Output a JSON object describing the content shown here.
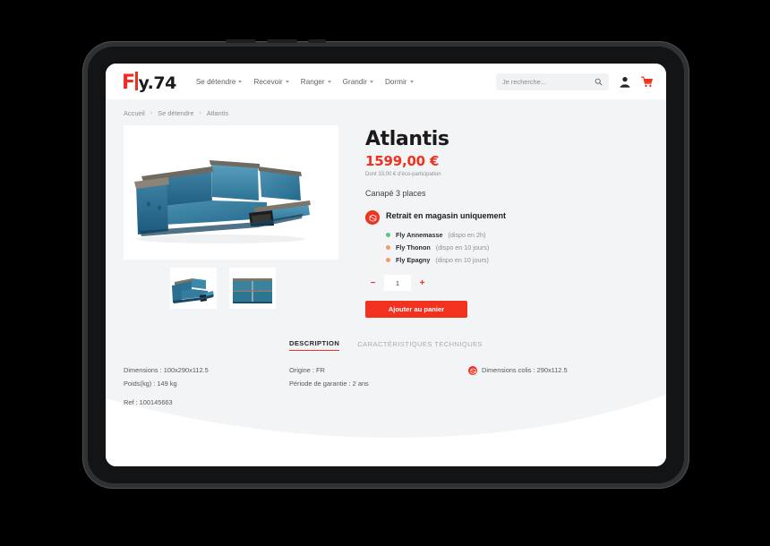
{
  "header": {
    "logo": {
      "prefix": "F",
      "suffix": "y.74"
    },
    "nav": [
      {
        "label": "Se détendre",
        "icon": "chevron-down-icon"
      },
      {
        "label": "Recevoir",
        "icon": "chevron-down-icon"
      },
      {
        "label": "Ranger",
        "icon": "chevron-down-icon"
      },
      {
        "label": "Grandir",
        "icon": "chevron-down-icon"
      },
      {
        "label": "Dormir",
        "icon": "chevron-down-icon"
      }
    ],
    "search": {
      "placeholder": "Je recherche...",
      "value": "",
      "icon": "search-icon"
    },
    "account_icon": "user-icon",
    "cart_icon": "shopping-cart-icon"
  },
  "breadcrumb": {
    "separator": "›",
    "items": [
      "Accueil",
      "Se détendre",
      "Atlantis"
    ]
  },
  "product": {
    "title": "Atlantis",
    "price": "1599,00 €",
    "eco": "Dont 33,00 € d'éco-participation",
    "subtitle": "Canapé 3 places",
    "pickup": {
      "icon": "store-pickup-icon",
      "title": "Retrait en magasin uniquement",
      "stores": [
        {
          "name": "Fly Annemasse",
          "availability": "(dispo en 2h)",
          "dot_color": "#5fc47e"
        },
        {
          "name": "Fly Thonon",
          "availability": "(dispo en 10 jours)",
          "dot_color": "#f59a62"
        },
        {
          "name": "Fly Epagny",
          "availability": "(dispo en 10 jours)",
          "dot_color": "#f59a62"
        }
      ]
    },
    "quantity": {
      "value": "1",
      "decrement": "−",
      "increment": "+"
    },
    "add_to_cart": "Ajouter au panier",
    "gallery": {
      "main_alt": "canape-atlantis-bleu-relax",
      "thumbs": [
        "canape-atlantis-vue-trois-quarts",
        "canape-atlantis-vue-face"
      ]
    }
  },
  "tabs": [
    {
      "label": "DESCRIPTION",
      "active": true
    },
    {
      "label": "CARACTÉRISTIQUES TECHNIQUES",
      "active": false
    }
  ],
  "specs": {
    "col1": [
      "Dimensions : 100x290x112.5",
      "Poids(kg) : 149 kg",
      "Ref : 100145663"
    ],
    "col2": [
      "Origine : FR",
      "Période de garantie : 2 ans"
    ],
    "col3": {
      "icon": "package-icon",
      "label": "Dimensions colis : 290x112.5"
    }
  },
  "colors": {
    "brand_red": "#f0321f",
    "page_bg": "#f3f4f6",
    "device_frame": "#2e3234",
    "text_dark": "#1b1b1b",
    "text_muted": "#8d9094"
  }
}
